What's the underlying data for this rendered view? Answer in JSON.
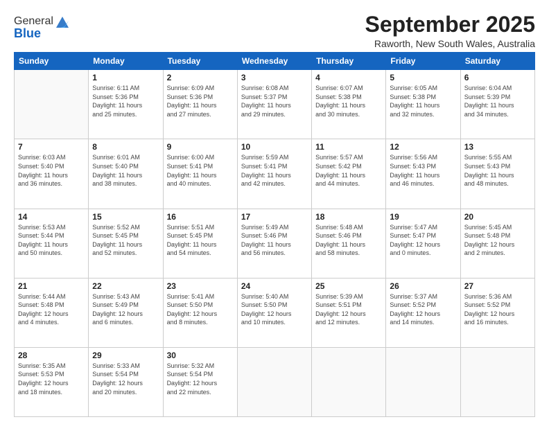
{
  "logo": {
    "general": "General",
    "blue": "Blue"
  },
  "title": "September 2025",
  "subtitle": "Raworth, New South Wales, Australia",
  "days_header": [
    "Sunday",
    "Monday",
    "Tuesday",
    "Wednesday",
    "Thursday",
    "Friday",
    "Saturday"
  ],
  "weeks": [
    [
      {
        "num": "",
        "info": ""
      },
      {
        "num": "1",
        "info": "Sunrise: 6:11 AM\nSunset: 5:36 PM\nDaylight: 11 hours\nand 25 minutes."
      },
      {
        "num": "2",
        "info": "Sunrise: 6:09 AM\nSunset: 5:36 PM\nDaylight: 11 hours\nand 27 minutes."
      },
      {
        "num": "3",
        "info": "Sunrise: 6:08 AM\nSunset: 5:37 PM\nDaylight: 11 hours\nand 29 minutes."
      },
      {
        "num": "4",
        "info": "Sunrise: 6:07 AM\nSunset: 5:38 PM\nDaylight: 11 hours\nand 30 minutes."
      },
      {
        "num": "5",
        "info": "Sunrise: 6:05 AM\nSunset: 5:38 PM\nDaylight: 11 hours\nand 32 minutes."
      },
      {
        "num": "6",
        "info": "Sunrise: 6:04 AM\nSunset: 5:39 PM\nDaylight: 11 hours\nand 34 minutes."
      }
    ],
    [
      {
        "num": "7",
        "info": "Sunrise: 6:03 AM\nSunset: 5:40 PM\nDaylight: 11 hours\nand 36 minutes."
      },
      {
        "num": "8",
        "info": "Sunrise: 6:01 AM\nSunset: 5:40 PM\nDaylight: 11 hours\nand 38 minutes."
      },
      {
        "num": "9",
        "info": "Sunrise: 6:00 AM\nSunset: 5:41 PM\nDaylight: 11 hours\nand 40 minutes."
      },
      {
        "num": "10",
        "info": "Sunrise: 5:59 AM\nSunset: 5:41 PM\nDaylight: 11 hours\nand 42 minutes."
      },
      {
        "num": "11",
        "info": "Sunrise: 5:57 AM\nSunset: 5:42 PM\nDaylight: 11 hours\nand 44 minutes."
      },
      {
        "num": "12",
        "info": "Sunrise: 5:56 AM\nSunset: 5:43 PM\nDaylight: 11 hours\nand 46 minutes."
      },
      {
        "num": "13",
        "info": "Sunrise: 5:55 AM\nSunset: 5:43 PM\nDaylight: 11 hours\nand 48 minutes."
      }
    ],
    [
      {
        "num": "14",
        "info": "Sunrise: 5:53 AM\nSunset: 5:44 PM\nDaylight: 11 hours\nand 50 minutes."
      },
      {
        "num": "15",
        "info": "Sunrise: 5:52 AM\nSunset: 5:45 PM\nDaylight: 11 hours\nand 52 minutes."
      },
      {
        "num": "16",
        "info": "Sunrise: 5:51 AM\nSunset: 5:45 PM\nDaylight: 11 hours\nand 54 minutes."
      },
      {
        "num": "17",
        "info": "Sunrise: 5:49 AM\nSunset: 5:46 PM\nDaylight: 11 hours\nand 56 minutes."
      },
      {
        "num": "18",
        "info": "Sunrise: 5:48 AM\nSunset: 5:46 PM\nDaylight: 11 hours\nand 58 minutes."
      },
      {
        "num": "19",
        "info": "Sunrise: 5:47 AM\nSunset: 5:47 PM\nDaylight: 12 hours\nand 0 minutes."
      },
      {
        "num": "20",
        "info": "Sunrise: 5:45 AM\nSunset: 5:48 PM\nDaylight: 12 hours\nand 2 minutes."
      }
    ],
    [
      {
        "num": "21",
        "info": "Sunrise: 5:44 AM\nSunset: 5:48 PM\nDaylight: 12 hours\nand 4 minutes."
      },
      {
        "num": "22",
        "info": "Sunrise: 5:43 AM\nSunset: 5:49 PM\nDaylight: 12 hours\nand 6 minutes."
      },
      {
        "num": "23",
        "info": "Sunrise: 5:41 AM\nSunset: 5:50 PM\nDaylight: 12 hours\nand 8 minutes."
      },
      {
        "num": "24",
        "info": "Sunrise: 5:40 AM\nSunset: 5:50 PM\nDaylight: 12 hours\nand 10 minutes."
      },
      {
        "num": "25",
        "info": "Sunrise: 5:39 AM\nSunset: 5:51 PM\nDaylight: 12 hours\nand 12 minutes."
      },
      {
        "num": "26",
        "info": "Sunrise: 5:37 AM\nSunset: 5:52 PM\nDaylight: 12 hours\nand 14 minutes."
      },
      {
        "num": "27",
        "info": "Sunrise: 5:36 AM\nSunset: 5:52 PM\nDaylight: 12 hours\nand 16 minutes."
      }
    ],
    [
      {
        "num": "28",
        "info": "Sunrise: 5:35 AM\nSunset: 5:53 PM\nDaylight: 12 hours\nand 18 minutes."
      },
      {
        "num": "29",
        "info": "Sunrise: 5:33 AM\nSunset: 5:54 PM\nDaylight: 12 hours\nand 20 minutes."
      },
      {
        "num": "30",
        "info": "Sunrise: 5:32 AM\nSunset: 5:54 PM\nDaylight: 12 hours\nand 22 minutes."
      },
      {
        "num": "",
        "info": ""
      },
      {
        "num": "",
        "info": ""
      },
      {
        "num": "",
        "info": ""
      },
      {
        "num": "",
        "info": ""
      }
    ]
  ]
}
